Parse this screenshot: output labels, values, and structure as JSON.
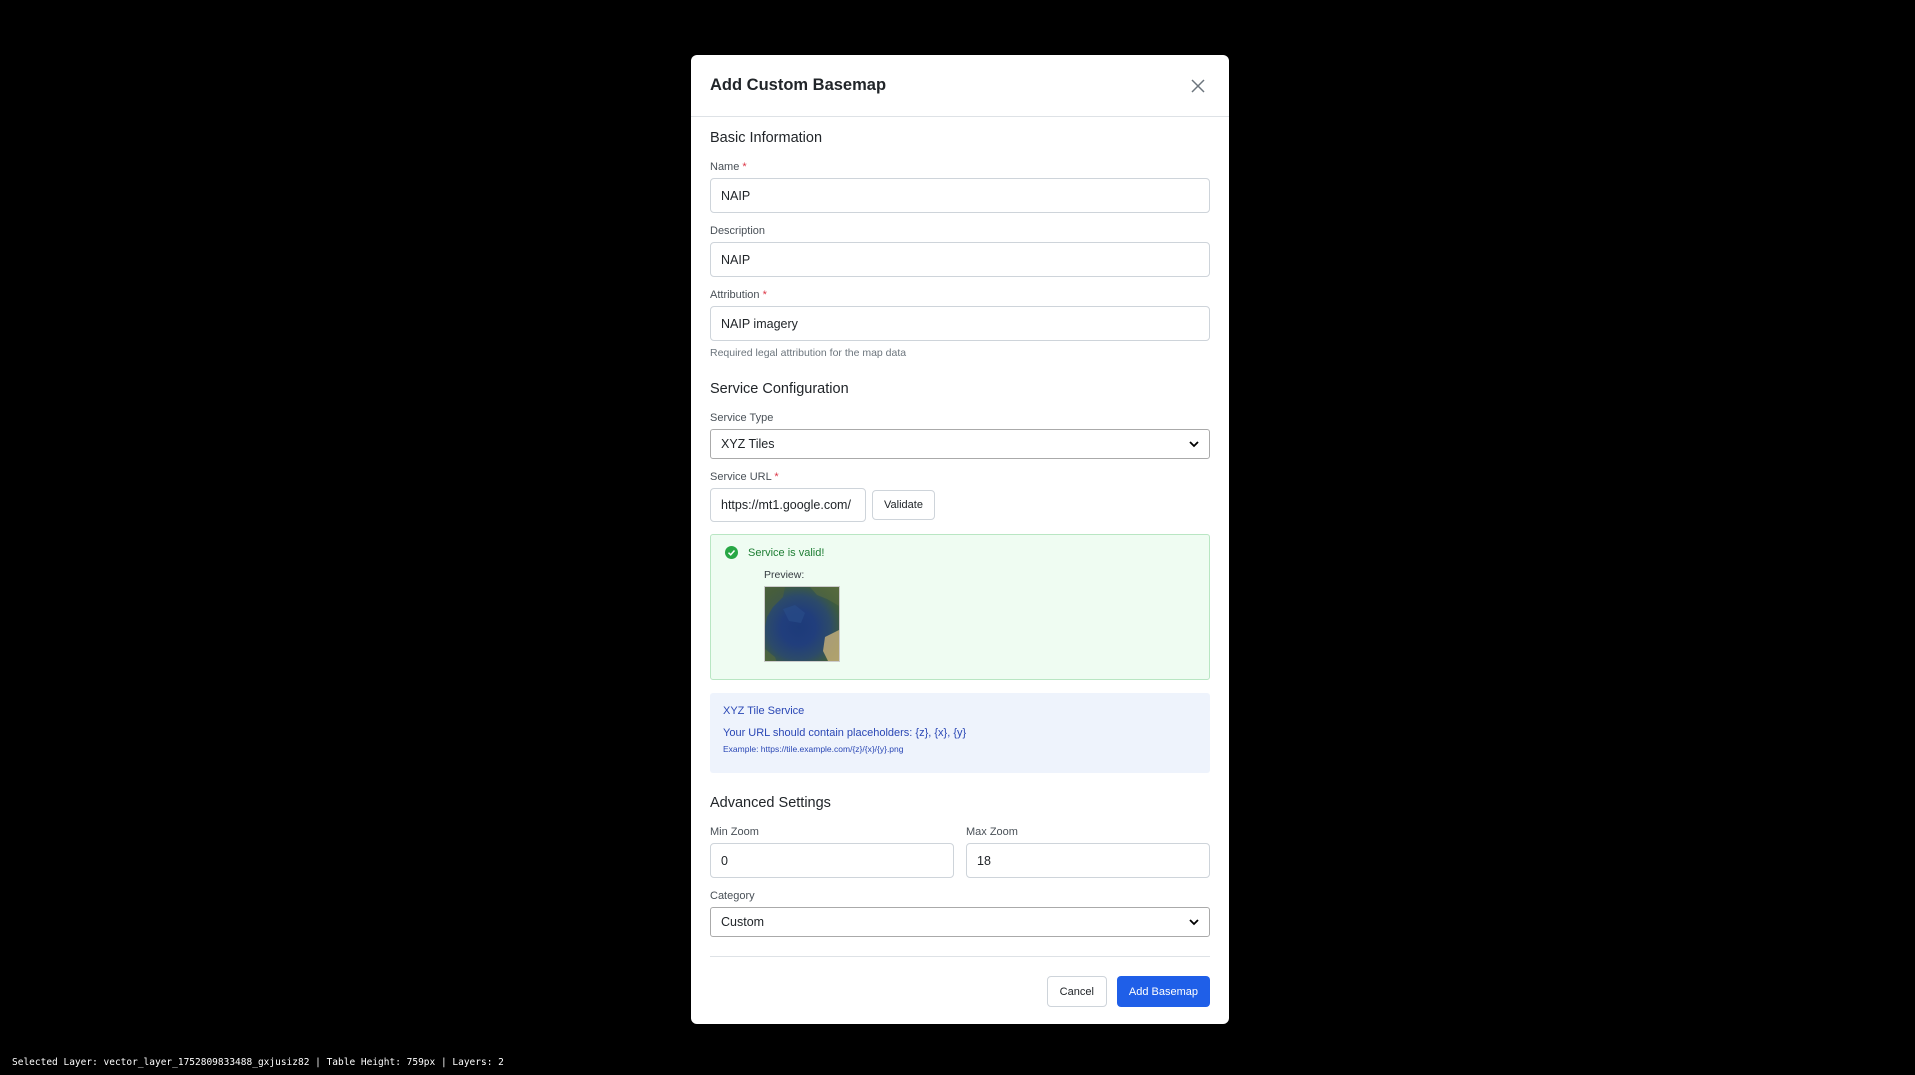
{
  "modal": {
    "title": "Add Custom Basemap",
    "close_icon": "close-icon"
  },
  "basic": {
    "section_title": "Basic Information",
    "name_label": "Name",
    "name_value": "NAIP",
    "description_label": "Description",
    "description_value": "NAIP",
    "attribution_label": "Attribution",
    "attribution_value": "NAIP imagery",
    "attribution_help": "Required legal attribution for the map data",
    "required_mark": "*"
  },
  "service": {
    "section_title": "Service Configuration",
    "type_label": "Service Type",
    "type_value": "XYZ Tiles",
    "url_label": "Service URL",
    "url_value": "https://mt1.google.com/",
    "validate_label": "Validate",
    "valid_message": "Service is valid!",
    "preview_label": "Preview:",
    "info_title": "XYZ Tile Service",
    "info_text": "Your URL should contain placeholders: {z}, {x}, {y}",
    "info_example": "Example: https://tile.example.com/{z}/{x}/{y}.png"
  },
  "advanced": {
    "section_title": "Advanced Settings",
    "min_zoom_label": "Min Zoom",
    "min_zoom_value": "0",
    "max_zoom_label": "Max Zoom",
    "max_zoom_value": "18",
    "category_label": "Category",
    "category_value": "Custom"
  },
  "footer": {
    "cancel_label": "Cancel",
    "submit_label": "Add Basemap"
  },
  "status_bar": {
    "text": "Selected Layer: vector_layer_1752809833488_gxjusiz82 | Table Height: 759px | Layers: 2"
  },
  "colors": {
    "primary": "#1f5fe8",
    "success": "#1e7e34",
    "info": "#2a47b5",
    "required": "#dc3545"
  }
}
